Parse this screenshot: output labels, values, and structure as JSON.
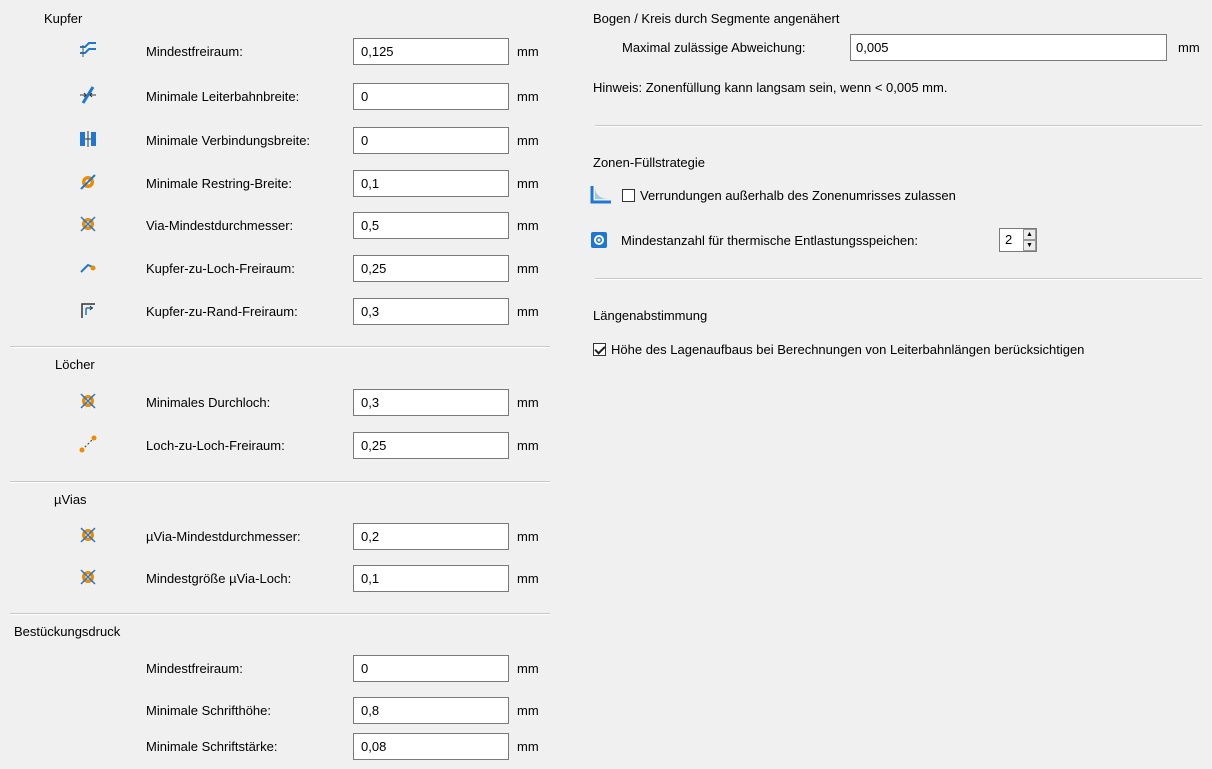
{
  "sections": {
    "copper": {
      "title": "Kupfer",
      "rows": [
        {
          "label": "Mindestfreiraum:",
          "value": "0,125",
          "unit": "mm",
          "icon": "clearance-icon"
        },
        {
          "label": "Minimale Leiterbahnbreite:",
          "value": "0",
          "unit": "mm",
          "icon": "track-width-icon"
        },
        {
          "label": "Minimale Verbindungsbreite:",
          "value": "0",
          "unit": "mm",
          "icon": "connection-width-icon"
        },
        {
          "label": "Minimale Restring-Breite:",
          "value": "0,1",
          "unit": "mm",
          "icon": "annular-ring-icon"
        },
        {
          "label": "Via-Mindestdurchmesser:",
          "value": "0,5",
          "unit": "mm",
          "icon": "via-diameter-icon"
        },
        {
          "label": "Kupfer-zu-Loch-Freiraum:",
          "value": "0,25",
          "unit": "mm",
          "icon": "copper-hole-clearance-icon"
        },
        {
          "label": "Kupfer-zu-Rand-Freiraum:",
          "value": "0,3",
          "unit": "mm",
          "icon": "copper-edge-clearance-icon"
        }
      ]
    },
    "holes": {
      "title": "Löcher",
      "rows": [
        {
          "label": "Minimales Durchloch:",
          "value": "0,3",
          "unit": "mm",
          "icon": "through-hole-icon"
        },
        {
          "label": "Loch-zu-Loch-Freiraum:",
          "value": "0,25",
          "unit": "mm",
          "icon": "hole-to-hole-icon"
        }
      ]
    },
    "microvias": {
      "title": "µVias",
      "rows": [
        {
          "label": "µVia-Mindestdurchmesser:",
          "value": "0,2",
          "unit": "mm",
          "icon": "microvia-diameter-icon"
        },
        {
          "label": "Mindestgröße µVia-Loch:",
          "value": "0,1",
          "unit": "mm",
          "icon": "microvia-hole-icon"
        }
      ]
    },
    "silkscreen": {
      "title": "Bestückungsdruck",
      "rows": [
        {
          "label": "Mindestfreiraum:",
          "value": "0",
          "unit": "mm"
        },
        {
          "label": "Minimale Schrifthöhe:",
          "value": "0,8",
          "unit": "mm"
        },
        {
          "label": "Minimale Schriftstärke:",
          "value": "0,08",
          "unit": "mm"
        }
      ]
    }
  },
  "arc": {
    "title": "Bogen / Kreis durch Segmente angenähert",
    "label": "Maximal zulässige Abweichung:",
    "value": "0,005",
    "unit": "mm",
    "hint": "Hinweis: Zonenfüllung kann langsam sein, wenn < 0,005 mm."
  },
  "zone": {
    "title": "Zonen-Füllstrategie",
    "fillets_label": "Verrundungen außerhalb des Zonenumrisses zulassen",
    "fillets_checked": false,
    "spokes_label": "Mindestanzahl für thermische Entlastungsspeichen:",
    "spokes_value": "2"
  },
  "length": {
    "title": "Längenabstimmung",
    "stackup_label": "Höhe des Lagenaufbaus bei Berechnungen von Leiterbahnlängen berücksichtigen",
    "stackup_checked": true
  },
  "colors": {
    "accent": "#1e78d2",
    "icon_orange": "#f08a00"
  }
}
